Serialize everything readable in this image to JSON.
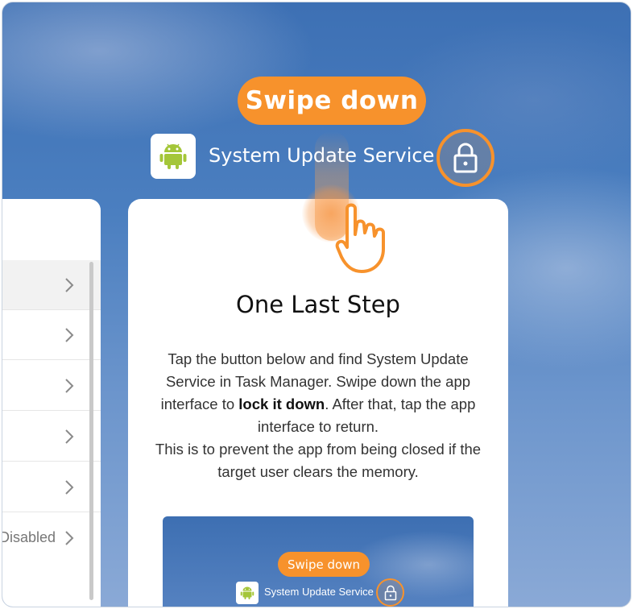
{
  "overlay": {
    "swipe_label": "Swipe down",
    "app_title": "System Update Service",
    "app_icon": "android-icon",
    "lock_icon": "lock-icon",
    "gesture_icon": "hand-swipe-icon"
  },
  "left_panel": {
    "rows": [
      {
        "text": ""
      },
      {
        "text": ""
      },
      {
        "text": ""
      },
      {
        "text": ""
      },
      {
        "text": ""
      },
      {
        "text": "Disabled"
      }
    ]
  },
  "card": {
    "title": "One Last Step",
    "body_part1": "Tap the button below and find System Update Service in Task Manager. Swipe down the app interface to ",
    "body_bold": "lock it down",
    "body_part2": ". After that, tap the app interface to return.",
    "body_part3": "This is to prevent the app from being closed if the target user clears the memory."
  },
  "preview": {
    "swipe_label": "Swipe down",
    "app_title": "System Update Service"
  },
  "colors": {
    "accent": "#f7922c",
    "android_green": "#a4c639",
    "background_blue": "#4b7fc0"
  }
}
